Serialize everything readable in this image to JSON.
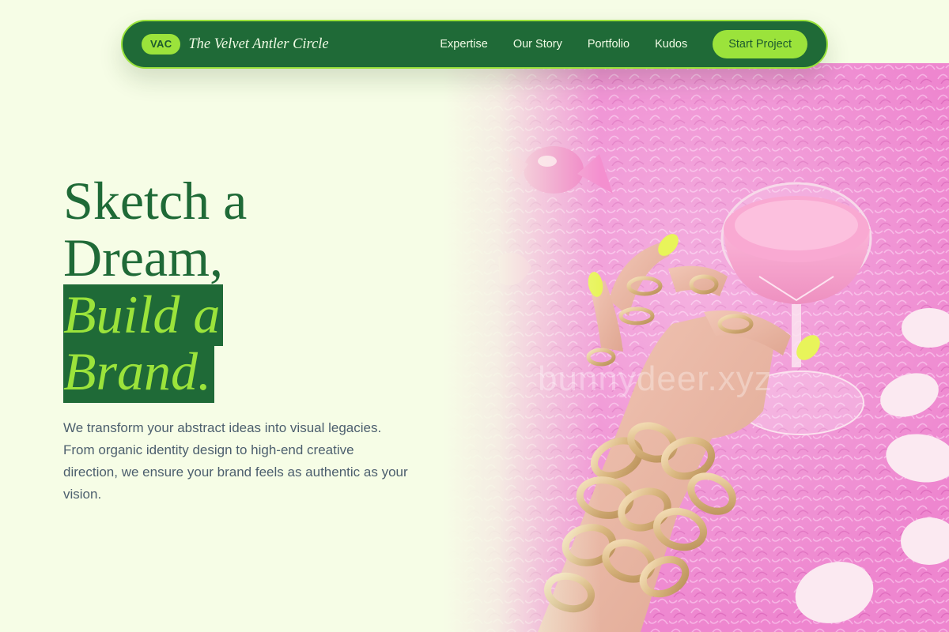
{
  "nav": {
    "logo_badge": "VAC",
    "brand_name": "The Velvet Antler Circle",
    "links": [
      "Expertise",
      "Our Story",
      "Portfolio",
      "Kudos"
    ],
    "cta_label": "Start Project"
  },
  "hero": {
    "headline_line1": "Sketch a",
    "headline_line2": "Dream,",
    "headline_highlight_line1": " Build a",
    "headline_highlight_line2": "Brand.",
    "lead": "We transform your abstract ideas into visual legacies. From organic identity design to high-end creative direction, we ensure your brand feels as authentic as your vision.",
    "image_watermark": "bunnydeer.xyz"
  },
  "colors": {
    "page_bg": "#f6fde6",
    "brand_green": "#1f6a37",
    "accent_lime": "#9be33b",
    "photo_pink": "#ef7fcb"
  }
}
